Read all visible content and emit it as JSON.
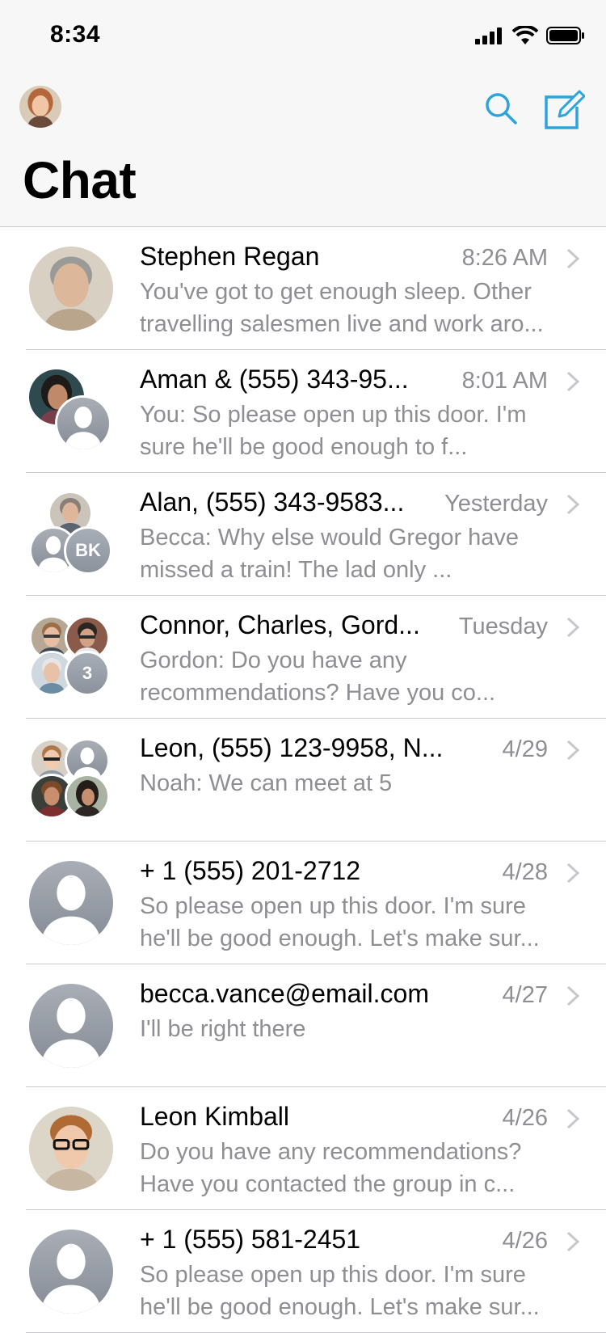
{
  "status_bar": {
    "time": "8:34"
  },
  "header": {
    "title": "Chat",
    "search_icon": "search-icon",
    "compose_icon": "compose-icon"
  },
  "colors": {
    "accent": "#2ea4dc",
    "secondary_text": "#8e8e93",
    "separator": "#c8c7cc",
    "header_bg": "#f7f7f7"
  },
  "chats": [
    {
      "name": "Stephen Regan",
      "time": "8:26 AM",
      "preview": "You've got to get enough sleep. Other travelling salesmen live and work aro..."
    },
    {
      "name": "Aman & (555) 343-95...",
      "time": "8:01 AM",
      "preview": "You: So please open up this door. I'm sure he'll be good enough to f..."
    },
    {
      "name": "Alan, (555) 343-9583...",
      "time": "Yesterday",
      "preview": "Becca: Why else would Gregor have missed a train! The lad only ...",
      "badge": "BK"
    },
    {
      "name": "Connor, Charles, Gord...",
      "time": "Tuesday",
      "preview": "Gordon: Do you have any recommendations? Have you co...",
      "badge": "3"
    },
    {
      "name": "Leon, (555) 123-9958, N...",
      "time": "4/29",
      "preview": "Noah: We can meet at 5"
    },
    {
      "name": "+ 1 (555) 201-2712",
      "time": "4/28",
      "preview": "So please open up this door. I'm sure he'll be good enough. Let's make sur..."
    },
    {
      "name": "becca.vance@email.com",
      "time": "4/27",
      "preview": "I'll be right there"
    },
    {
      "name": "Leon Kimball",
      "time": "4/26",
      "preview": "Do you have any recommendations? Have you contacted the group in c..."
    },
    {
      "name": "+ 1 (555) 581-2451",
      "time": "4/26",
      "preview": "So please open up this door. I'm sure he'll be good enough. Let's make sur..."
    }
  ]
}
